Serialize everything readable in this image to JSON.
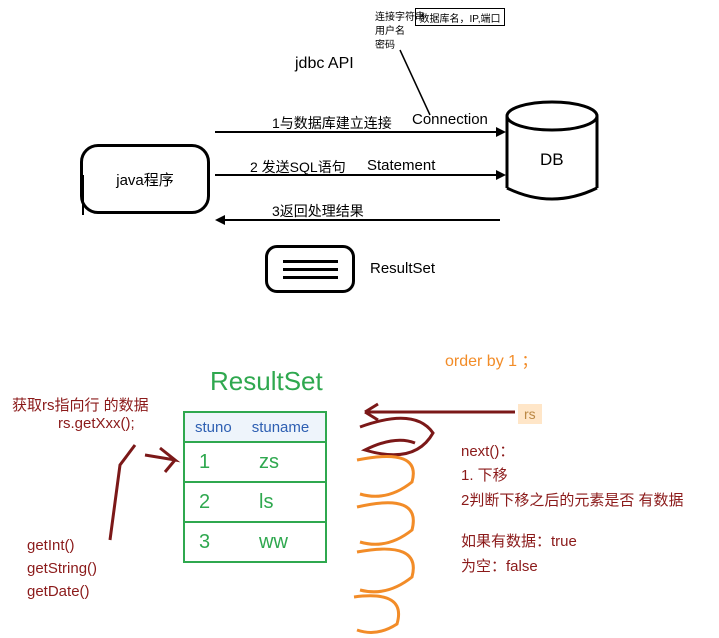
{
  "top": {
    "api_label": "jdbc API",
    "conn_label_line1": "连接字符串",
    "conn_label_line2": "用户名",
    "conn_label_line3": "密码",
    "dbinfo_box": "数据库名，IP,端口",
    "java_box": "java程序",
    "db_label": "DB",
    "arrow1": "1与数据库建立连接",
    "arrow1_obj": "Connection",
    "arrow2": "2 发送SQL语句",
    "arrow2_obj": "Statement",
    "arrow3": "3返回处理结果",
    "resultset_label": "ResultSet"
  },
  "orderby": "order by 1 ；",
  "rs_title": "ResultSet",
  "left_notes": {
    "line1": "获取rs指向行 的数据",
    "line2": "rs.getXxx();",
    "m1": "getInt()",
    "m2": "getString()",
    "m3": "getDate()"
  },
  "table": {
    "h1": "stuno",
    "h2": "stuname",
    "rows": [
      {
        "no": "1",
        "name": "zs"
      },
      {
        "no": "2",
        "name": "ls"
      },
      {
        "no": "3",
        "name": "ww"
      }
    ]
  },
  "rs_label": "rs",
  "right_notes": {
    "next": "next()：",
    "l1": "1. 下移",
    "l2": "2判断下移之后的元素是否 有数据",
    "l3": "如果有数据：true",
    "l4": "为空：false"
  }
}
